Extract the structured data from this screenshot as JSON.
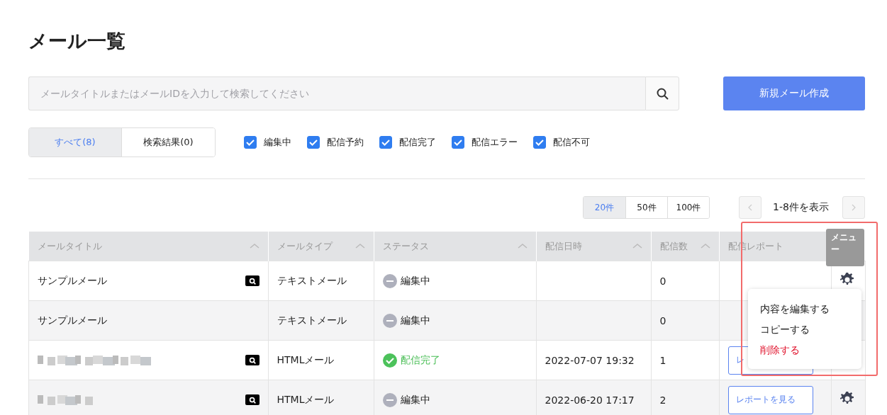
{
  "page_title": "メール一覧",
  "search": {
    "placeholder": "メールタイトルまたはメールIDを入力して検索してください"
  },
  "new_button": "新規メール作成",
  "tabs": [
    {
      "label": "すべて(8)",
      "selected": true
    },
    {
      "label": "検索結果(0)",
      "selected": false
    }
  ],
  "filters": [
    {
      "label": "編集中",
      "checked": true
    },
    {
      "label": "配信予約",
      "checked": true
    },
    {
      "label": "配信完了",
      "checked": true
    },
    {
      "label": "配信エラー",
      "checked": true
    },
    {
      "label": "配信不可",
      "checked": true
    }
  ],
  "page_sizes": [
    {
      "label": "20件",
      "selected": true
    },
    {
      "label": "50件",
      "selected": false
    },
    {
      "label": "100件",
      "selected": false
    }
  ],
  "range_text": "1-8件を表示",
  "table": {
    "columns": [
      {
        "label": "メールタイトル",
        "sortable": true
      },
      {
        "label": "メールタイプ",
        "sortable": true
      },
      {
        "label": "ステータス",
        "sortable": true
      },
      {
        "label": "配信日時",
        "sortable": true
      },
      {
        "label": "配信数",
        "sortable": true
      },
      {
        "label": "配信レポート",
        "sortable": false
      },
      {
        "label": "メニュー"
      }
    ],
    "rows": [
      {
        "title": {
          "kind": "text",
          "text": "サンプルメール"
        },
        "preview": true,
        "type": "テキストメール",
        "status": {
          "kind": "editing",
          "label": "編集中"
        },
        "date": "",
        "count": "0",
        "gear": true
      },
      {
        "title": {
          "kind": "text",
          "text": "サンプルメール"
        },
        "preview": false,
        "type": "テキストメール",
        "status": {
          "kind": "editing",
          "label": "編集中"
        },
        "date": "",
        "count": "0",
        "gear": false
      },
      {
        "title": {
          "kind": "redacted"
        },
        "preview": true,
        "type": "HTMLメール",
        "status": {
          "kind": "done",
          "label": "配信完了"
        },
        "date": "2022-07-07 19:32",
        "count": "1",
        "report": "レ",
        "gear": false
      },
      {
        "title": {
          "kind": "redacted"
        },
        "preview": true,
        "type": "HTMLメール",
        "status": {
          "kind": "editing",
          "label": "編集中"
        },
        "date": "2022-06-20 17:17",
        "count": "2",
        "report": "レポートを見る",
        "gear": true
      }
    ]
  },
  "context_menu": [
    {
      "label": "内容を編集する",
      "kind": "normal"
    },
    {
      "label": "コピーする",
      "kind": "normal"
    },
    {
      "label": "削除する",
      "kind": "danger"
    }
  ]
}
